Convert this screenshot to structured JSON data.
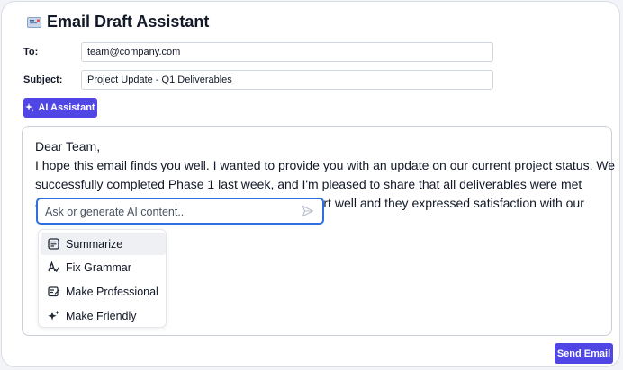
{
  "header": {
    "icon": "envelope-icon",
    "title": "Email Draft Assistant"
  },
  "form": {
    "to_label": "To:",
    "to_value": "team@company.com",
    "subject_label": "Subject:",
    "subject_value": "Project Update - Q1 Deliverables"
  },
  "toolbar": {
    "ai_button_label": "AI Assistant",
    "ai_icon": "sparkle-icon"
  },
  "editor": {
    "lines": [
      "Dear Team,",
      "I hope this email finds you well. I wanted to provide you with an update on our current project status. We",
      "successfully completed Phase 1 last week, and I'm pleased to share that all deliverables were met",
      "according to schedule. The client accepted the report well and they expressed satisfaction with our"
    ]
  },
  "ai_prompt": {
    "placeholder": "Ask or generate AI content..",
    "send_icon": "send-icon"
  },
  "menu": {
    "items": [
      {
        "label": "Summarize",
        "icon": "summarize-icon",
        "active": true
      },
      {
        "label": "Fix Grammar",
        "icon": "grammar-icon",
        "active": false
      },
      {
        "label": "Make Professional",
        "icon": "professional-icon",
        "active": false
      },
      {
        "label": "Make Friendly",
        "icon": "friendly-icon",
        "active": false
      }
    ]
  },
  "footer": {
    "send_label": "Send Email"
  },
  "colors": {
    "accent": "#4f46e5",
    "focus": "#2f6fe0"
  }
}
